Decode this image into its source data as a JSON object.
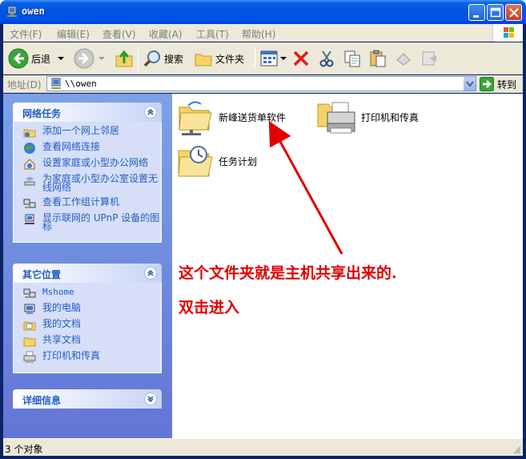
{
  "window": {
    "title": "owen"
  },
  "menu": {
    "items": [
      "文件(F)",
      "编辑(E)",
      "查看(V)",
      "收藏(A)",
      "工具(T)",
      "帮助(H)"
    ]
  },
  "toolbar": {
    "back_label": "后退",
    "search_label": "搜索",
    "folders_label": "文件夹"
  },
  "address": {
    "label": "地址(D)",
    "value": "\\\\owen",
    "go_label": "转到"
  },
  "network_tasks": {
    "title": "网络任务",
    "links": [
      "添加一个网上邻居",
      "查看网络连接",
      "设置家庭或小型办公网络",
      "为家庭或小型办公室设置无线网络",
      "查看工作组计算机",
      "显示联网的 UPnP 设备的图标"
    ]
  },
  "other_places": {
    "title": "其它位置",
    "links": [
      "Mshome",
      "我的电脑",
      "我的文档",
      "共享文档",
      "打印机和传真"
    ]
  },
  "details": {
    "title": "详细信息"
  },
  "content": {
    "items": [
      {
        "label": "新峰送货单软件",
        "icon": "shared-folder-icon"
      },
      {
        "label": "打印机和传真",
        "icon": "printer-icon"
      },
      {
        "label": "任务计划",
        "icon": "scheduled-tasks-icon"
      }
    ],
    "annotation_line1": "这个文件夹就是主机共享出来的.",
    "annotation_line2": "双击进入",
    "annotation_color": "#e00000"
  },
  "status": {
    "text": "3 个对象"
  },
  "colors": {
    "titlebar": "#0053e0",
    "taskpane_link": "#215dc6",
    "taskpane_bg": "#d6dff7"
  }
}
